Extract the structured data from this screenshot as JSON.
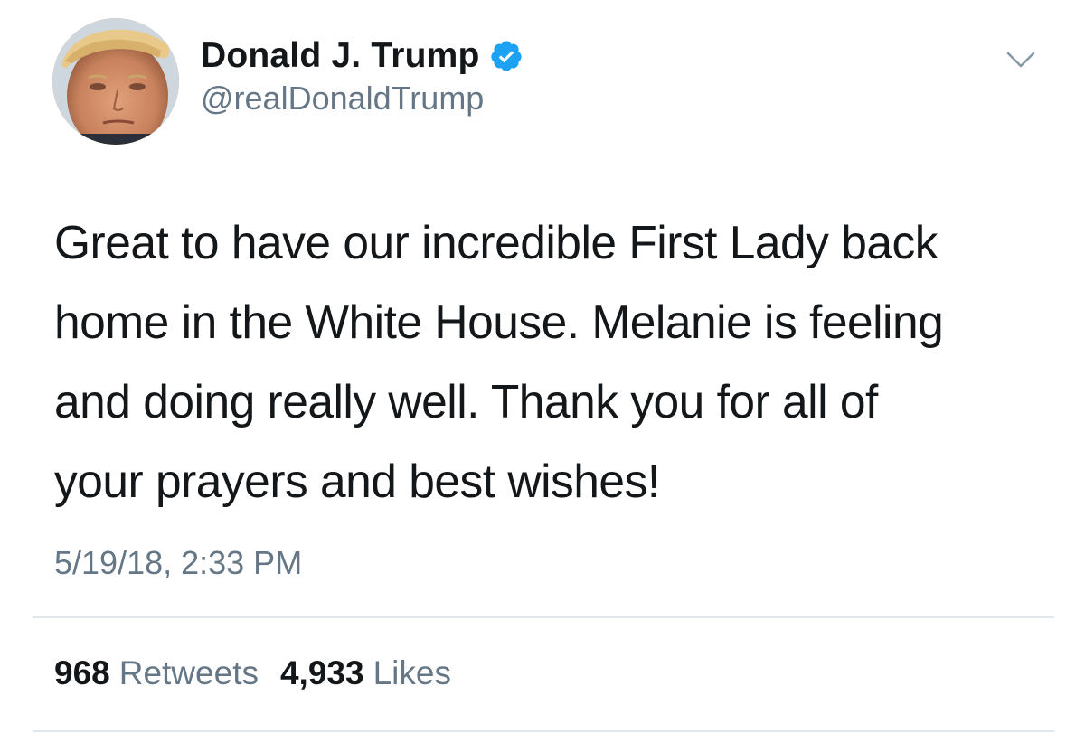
{
  "user": {
    "display_name": "Donald J. Trump",
    "handle": "@realDonaldTrump",
    "verified": true,
    "avatar": "profile-photo"
  },
  "tweet": {
    "lines": [
      "Great to have our incredible First Lady back",
      "home in the White House. Melanie is feeling",
      "and doing really well. Thank you for all of",
      "your prayers and best wishes!"
    ],
    "timestamp": "5/19/18, 2:33 PM"
  },
  "stats": {
    "retweets": {
      "count": "968",
      "label": "Retweets"
    },
    "likes": {
      "count": "4,933",
      "label": "Likes"
    }
  },
  "icons": {
    "verified": "verified-badge-icon",
    "caret": "chevron-down-icon"
  },
  "colors": {
    "text": "#14171a",
    "secondary": "#657786",
    "verified": "#1da1f2",
    "divider": "#e1e8ed"
  }
}
